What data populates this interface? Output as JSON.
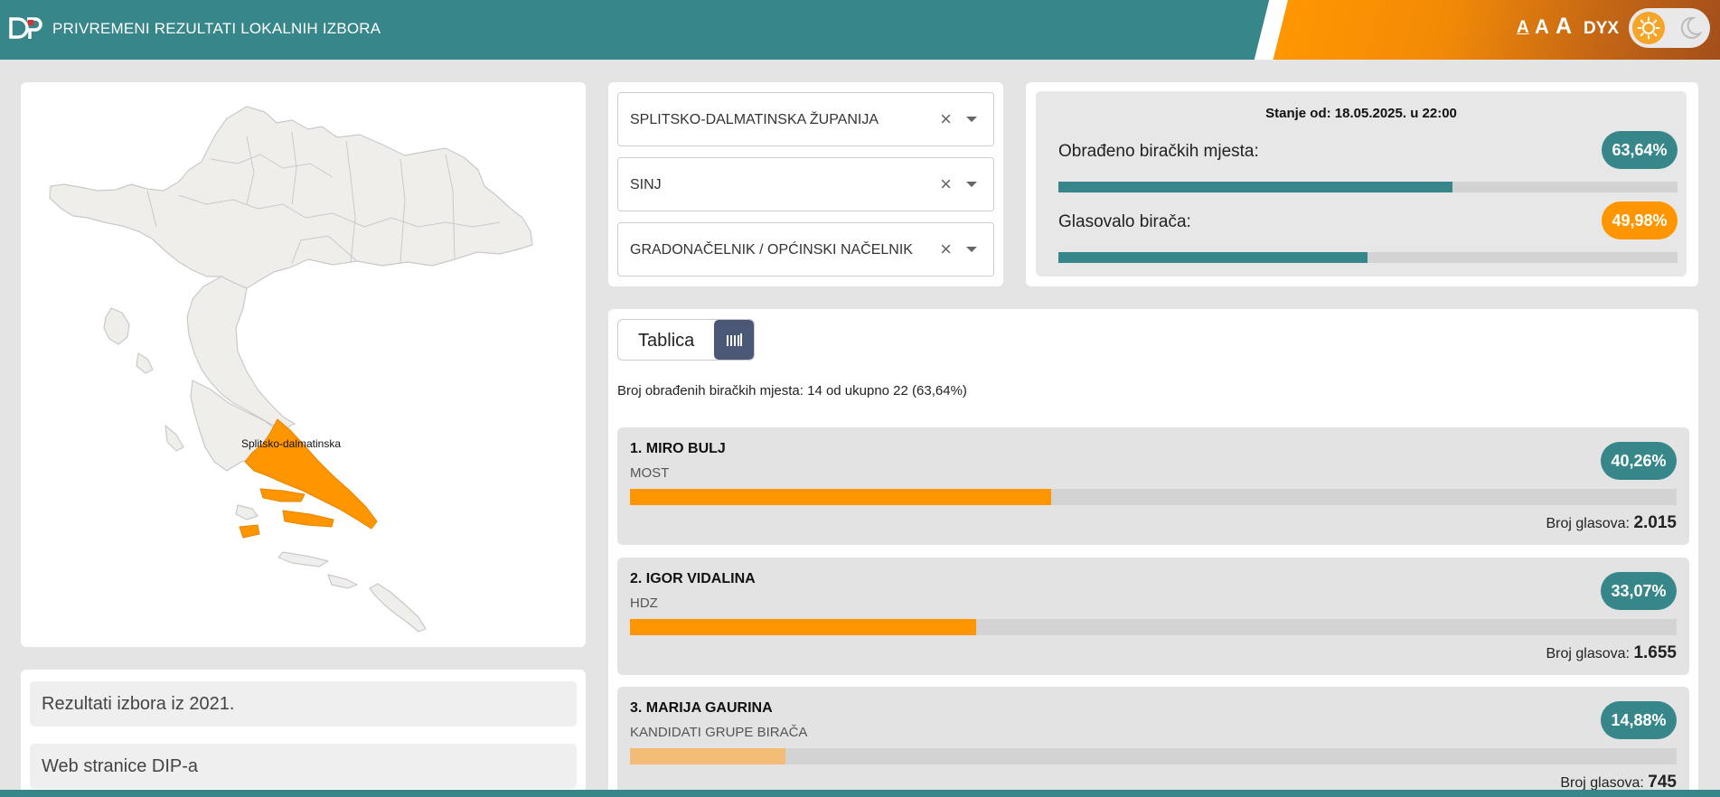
{
  "header": {
    "title": "PRIVREMENI REZULTATI LOKALNIH IZBORA",
    "font_small": "A",
    "font_medium": "A",
    "font_large": "A",
    "dyslexia_label": "DYX",
    "logo_icon": "dip-logo-icon",
    "theme_icons": [
      "sun-icon",
      "moon-icon"
    ]
  },
  "map": {
    "highlighted_region_label": "Splitsko-dalmatinska"
  },
  "filters": {
    "county": "SPLITSKO-DALMATINSKA ŽUPANIJA",
    "municipality": "SINJ",
    "election_type": "GRADONAČELNIK / OPĆINSKI NAČELNIK",
    "clear_glyph": "×"
  },
  "status": {
    "date_text": "Stanje od: 18.05.2025. u 22:00",
    "processed_label": "Obrađeno biračkih mjesta:",
    "processed_pct": "63,64%",
    "processed_value": 0.6364,
    "turnout_label": "Glasovalo birača:",
    "turnout_pct": "49,98%",
    "turnout_value": 0.4998
  },
  "results": {
    "view_label": "Tablica",
    "chart_icon": "bar-chart-icon",
    "processed_text": "Broj obrađenih biračkih mjesta: 14 od ukupno 22 (63,64%)",
    "votes_label": "Broj glasova:",
    "candidates": [
      {
        "name": "1. MIRO BULJ",
        "party": "MOST",
        "pct": "40,26%",
        "value": 0.4026,
        "votes": "2.015"
      },
      {
        "name": "2. IGOR VIDALINA",
        "party": "HDZ",
        "pct": "33,07%",
        "value": 0.3307,
        "votes": "1.655"
      },
      {
        "name": "3. MARIJA GAURINA",
        "party": "KANDIDATI GRUPE BIRAČA",
        "pct": "14,88%",
        "value": 0.1488,
        "votes": "745"
      }
    ]
  },
  "links": {
    "previous_results": "Rezultati izbora iz 2021.",
    "website": "Web stranice DIP-a"
  },
  "colors": {
    "teal": "#37878a",
    "orange": "#ff9600",
    "orange_light": "#f3bd77",
    "navy": "#4a5775"
  }
}
